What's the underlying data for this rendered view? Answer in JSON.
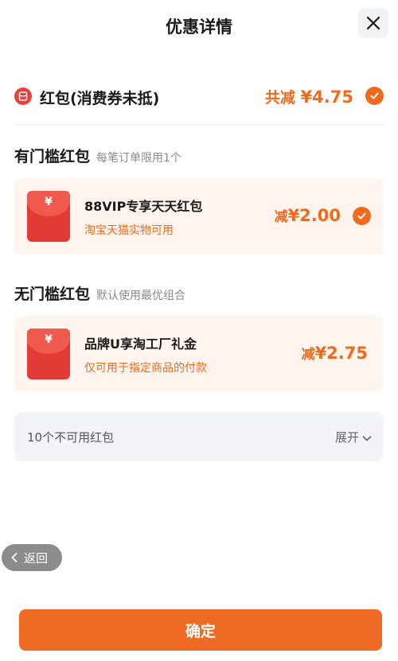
{
  "header": {
    "title": "优惠详情"
  },
  "summary": {
    "label": "红包(消费券未抵)",
    "total_prefix": "共减",
    "total_amount": "¥4.75"
  },
  "sections": [
    {
      "title": "有门槛红包",
      "subtitle": "每笔订单限用1个",
      "coupon": {
        "title": "88VIP专享天天红包",
        "desc": "淘宝天猫实物可用",
        "amount_prefix": "减",
        "amount": "¥2.00",
        "selected": true
      }
    },
    {
      "title": "无门槛红包",
      "subtitle": "默认使用最优组合",
      "coupon": {
        "title": "品牌U享淘工厂礼金",
        "desc": "仅可用于指定商品的付款",
        "amount_prefix": "减",
        "amount": "¥2.75",
        "selected": false
      }
    }
  ],
  "envelope_symbol": "¥",
  "unavailable": {
    "label": "10个不可用红包",
    "expand_label": "展开"
  },
  "back": {
    "label": "返回"
  },
  "confirm": {
    "label": "确定"
  },
  "colors": {
    "accent": "#ef6a1c",
    "card_bg": "#fff5ee",
    "envelope": "#e23a35"
  },
  "icons": [
    "close-icon",
    "red-packet-icon",
    "check-circle-icon",
    "chevron-down-icon",
    "chevron-left-icon"
  ]
}
